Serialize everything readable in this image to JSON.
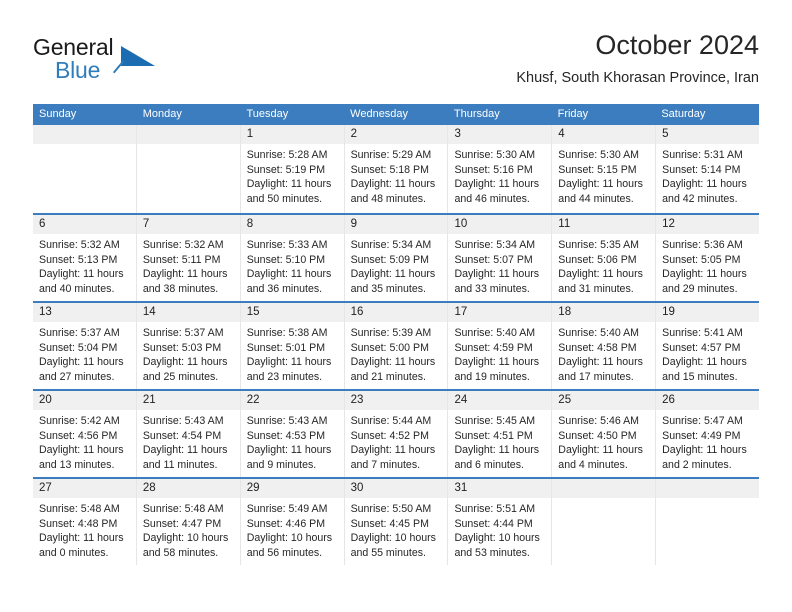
{
  "brand": {
    "name_top": "General",
    "name_bottom": "Blue"
  },
  "header": {
    "title": "October 2024",
    "subtitle": "Khusf, South Khorasan Province, Iran"
  },
  "weekdays": [
    "Sunday",
    "Monday",
    "Tuesday",
    "Wednesday",
    "Thursday",
    "Friday",
    "Saturday"
  ],
  "colors": {
    "header_blue": "#3b7dbf",
    "daynum_grey": "#f0f0f0",
    "brand_blue": "#2e7ebb",
    "text": "#262626"
  },
  "weeks": [
    [
      {
        "day": "",
        "sunrise": "",
        "sunset": "",
        "daylight1": "",
        "daylight2": ""
      },
      {
        "day": "",
        "sunrise": "",
        "sunset": "",
        "daylight1": "",
        "daylight2": ""
      },
      {
        "day": "1",
        "sunrise": "Sunrise: 5:28 AM",
        "sunset": "Sunset: 5:19 PM",
        "daylight1": "Daylight: 11 hours",
        "daylight2": "and 50 minutes."
      },
      {
        "day": "2",
        "sunrise": "Sunrise: 5:29 AM",
        "sunset": "Sunset: 5:18 PM",
        "daylight1": "Daylight: 11 hours",
        "daylight2": "and 48 minutes."
      },
      {
        "day": "3",
        "sunrise": "Sunrise: 5:30 AM",
        "sunset": "Sunset: 5:16 PM",
        "daylight1": "Daylight: 11 hours",
        "daylight2": "and 46 minutes."
      },
      {
        "day": "4",
        "sunrise": "Sunrise: 5:30 AM",
        "sunset": "Sunset: 5:15 PM",
        "daylight1": "Daylight: 11 hours",
        "daylight2": "and 44 minutes."
      },
      {
        "day": "5",
        "sunrise": "Sunrise: 5:31 AM",
        "sunset": "Sunset: 5:14 PM",
        "daylight1": "Daylight: 11 hours",
        "daylight2": "and 42 minutes."
      }
    ],
    [
      {
        "day": "6",
        "sunrise": "Sunrise: 5:32 AM",
        "sunset": "Sunset: 5:13 PM",
        "daylight1": "Daylight: 11 hours",
        "daylight2": "and 40 minutes."
      },
      {
        "day": "7",
        "sunrise": "Sunrise: 5:32 AM",
        "sunset": "Sunset: 5:11 PM",
        "daylight1": "Daylight: 11 hours",
        "daylight2": "and 38 minutes."
      },
      {
        "day": "8",
        "sunrise": "Sunrise: 5:33 AM",
        "sunset": "Sunset: 5:10 PM",
        "daylight1": "Daylight: 11 hours",
        "daylight2": "and 36 minutes."
      },
      {
        "day": "9",
        "sunrise": "Sunrise: 5:34 AM",
        "sunset": "Sunset: 5:09 PM",
        "daylight1": "Daylight: 11 hours",
        "daylight2": "and 35 minutes."
      },
      {
        "day": "10",
        "sunrise": "Sunrise: 5:34 AM",
        "sunset": "Sunset: 5:07 PM",
        "daylight1": "Daylight: 11 hours",
        "daylight2": "and 33 minutes."
      },
      {
        "day": "11",
        "sunrise": "Sunrise: 5:35 AM",
        "sunset": "Sunset: 5:06 PM",
        "daylight1": "Daylight: 11 hours",
        "daylight2": "and 31 minutes."
      },
      {
        "day": "12",
        "sunrise": "Sunrise: 5:36 AM",
        "sunset": "Sunset: 5:05 PM",
        "daylight1": "Daylight: 11 hours",
        "daylight2": "and 29 minutes."
      }
    ],
    [
      {
        "day": "13",
        "sunrise": "Sunrise: 5:37 AM",
        "sunset": "Sunset: 5:04 PM",
        "daylight1": "Daylight: 11 hours",
        "daylight2": "and 27 minutes."
      },
      {
        "day": "14",
        "sunrise": "Sunrise: 5:37 AM",
        "sunset": "Sunset: 5:03 PM",
        "daylight1": "Daylight: 11 hours",
        "daylight2": "and 25 minutes."
      },
      {
        "day": "15",
        "sunrise": "Sunrise: 5:38 AM",
        "sunset": "Sunset: 5:01 PM",
        "daylight1": "Daylight: 11 hours",
        "daylight2": "and 23 minutes."
      },
      {
        "day": "16",
        "sunrise": "Sunrise: 5:39 AM",
        "sunset": "Sunset: 5:00 PM",
        "daylight1": "Daylight: 11 hours",
        "daylight2": "and 21 minutes."
      },
      {
        "day": "17",
        "sunrise": "Sunrise: 5:40 AM",
        "sunset": "Sunset: 4:59 PM",
        "daylight1": "Daylight: 11 hours",
        "daylight2": "and 19 minutes."
      },
      {
        "day": "18",
        "sunrise": "Sunrise: 5:40 AM",
        "sunset": "Sunset: 4:58 PM",
        "daylight1": "Daylight: 11 hours",
        "daylight2": "and 17 minutes."
      },
      {
        "day": "19",
        "sunrise": "Sunrise: 5:41 AM",
        "sunset": "Sunset: 4:57 PM",
        "daylight1": "Daylight: 11 hours",
        "daylight2": "and 15 minutes."
      }
    ],
    [
      {
        "day": "20",
        "sunrise": "Sunrise: 5:42 AM",
        "sunset": "Sunset: 4:56 PM",
        "daylight1": "Daylight: 11 hours",
        "daylight2": "and 13 minutes."
      },
      {
        "day": "21",
        "sunrise": "Sunrise: 5:43 AM",
        "sunset": "Sunset: 4:54 PM",
        "daylight1": "Daylight: 11 hours",
        "daylight2": "and 11 minutes."
      },
      {
        "day": "22",
        "sunrise": "Sunrise: 5:43 AM",
        "sunset": "Sunset: 4:53 PM",
        "daylight1": "Daylight: 11 hours",
        "daylight2": "and 9 minutes."
      },
      {
        "day": "23",
        "sunrise": "Sunrise: 5:44 AM",
        "sunset": "Sunset: 4:52 PM",
        "daylight1": "Daylight: 11 hours",
        "daylight2": "and 7 minutes."
      },
      {
        "day": "24",
        "sunrise": "Sunrise: 5:45 AM",
        "sunset": "Sunset: 4:51 PM",
        "daylight1": "Daylight: 11 hours",
        "daylight2": "and 6 minutes."
      },
      {
        "day": "25",
        "sunrise": "Sunrise: 5:46 AM",
        "sunset": "Sunset: 4:50 PM",
        "daylight1": "Daylight: 11 hours",
        "daylight2": "and 4 minutes."
      },
      {
        "day": "26",
        "sunrise": "Sunrise: 5:47 AM",
        "sunset": "Sunset: 4:49 PM",
        "daylight1": "Daylight: 11 hours",
        "daylight2": "and 2 minutes."
      }
    ],
    [
      {
        "day": "27",
        "sunrise": "Sunrise: 5:48 AM",
        "sunset": "Sunset: 4:48 PM",
        "daylight1": "Daylight: 11 hours",
        "daylight2": "and 0 minutes."
      },
      {
        "day": "28",
        "sunrise": "Sunrise: 5:48 AM",
        "sunset": "Sunset: 4:47 PM",
        "daylight1": "Daylight: 10 hours",
        "daylight2": "and 58 minutes."
      },
      {
        "day": "29",
        "sunrise": "Sunrise: 5:49 AM",
        "sunset": "Sunset: 4:46 PM",
        "daylight1": "Daylight: 10 hours",
        "daylight2": "and 56 minutes."
      },
      {
        "day": "30",
        "sunrise": "Sunrise: 5:50 AM",
        "sunset": "Sunset: 4:45 PM",
        "daylight1": "Daylight: 10 hours",
        "daylight2": "and 55 minutes."
      },
      {
        "day": "31",
        "sunrise": "Sunrise: 5:51 AM",
        "sunset": "Sunset: 4:44 PM",
        "daylight1": "Daylight: 10 hours",
        "daylight2": "and 53 minutes."
      },
      {
        "day": "",
        "sunrise": "",
        "sunset": "",
        "daylight1": "",
        "daylight2": ""
      },
      {
        "day": "",
        "sunrise": "",
        "sunset": "",
        "daylight1": "",
        "daylight2": ""
      }
    ]
  ]
}
